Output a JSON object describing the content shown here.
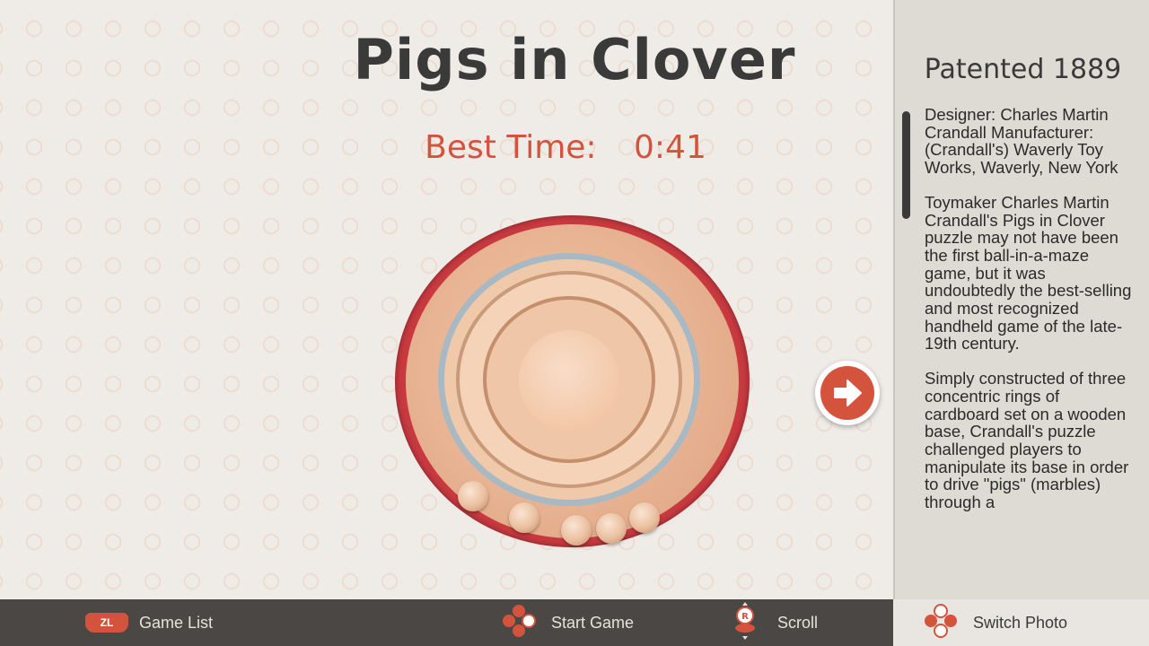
{
  "game": {
    "title": "Pigs in Clover",
    "best_time_label": "Best Time:",
    "best_time_value": "0:41"
  },
  "side_panel": {
    "title": "Patented 1889",
    "credits": "Designer: Charles Martin Crandall Manufacturer: (Crandall's) Waverly Toy Works, Waverly, New York",
    "paragraph1": "Toymaker Charles Martin Crandall's Pigs in Clover puzzle may not have been the first ball-in-a-maze game, but it was undoubtedly the best-selling and most recognized handheld game of the late-19th century.",
    "paragraph2": "Simply constructed of three concentric rings of cardboard set on a wooden base, Crandall's puzzle challenged players to manipulate its base in order to drive \"pigs\" (marbles) through a"
  },
  "bottom_bar": {
    "zl_badge": "ZL",
    "game_list": "Game List",
    "start_game": "Start Game",
    "r_badge": "R",
    "scroll": "Scroll",
    "switch_photo": "Switch Photo"
  },
  "icons": {
    "next": "arrow-right-icon",
    "zl": "zl-button-icon",
    "dpad_start": "dpad-icon",
    "r_stick": "r-stick-icon",
    "dpad_switch": "dpad-icon"
  },
  "colors": {
    "accent": "#d4533d",
    "background": "#efece8",
    "panel": "#dedad4",
    "bottom_bar": "#4a4744",
    "title_text": "#3a3a3a"
  }
}
